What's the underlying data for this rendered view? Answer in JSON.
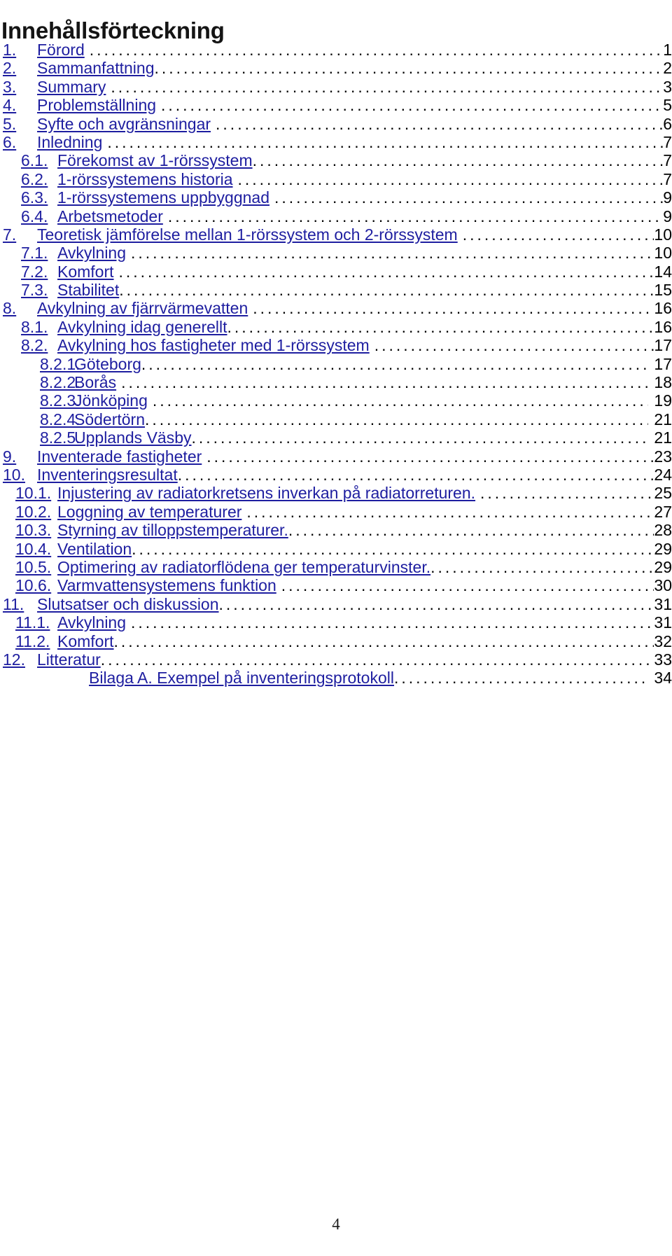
{
  "document": {
    "title": "Innehållsförteckning",
    "footer_page_number": "4",
    "link_color": "#1e1ea0",
    "title_color": "#141414",
    "page_number_color": "#000000"
  },
  "toc": {
    "entries": [
      {
        "level": 1,
        "number": "1.",
        "label": "Förord",
        "page": "1",
        "space_before_dots": true,
        "space_after_dots": false
      },
      {
        "level": 1,
        "number": "2.",
        "label": "Sammanfattning",
        "page": "2",
        "space_before_dots": false,
        "space_after_dots": false
      },
      {
        "level": 1,
        "number": "3.",
        "label": "Summary",
        "page": "3",
        "space_before_dots": true,
        "space_after_dots": false
      },
      {
        "level": 1,
        "number": "4.",
        "label": "Problemställning",
        "page": "5",
        "space_before_dots": true,
        "space_after_dots": false
      },
      {
        "level": 1,
        "number": "5.",
        "label": "Syfte och avgränsningar",
        "page": "6",
        "space_before_dots": true,
        "space_after_dots": false
      },
      {
        "level": 1,
        "number": "6.",
        "label": "Inledning",
        "page": "7",
        "space_before_dots": true,
        "space_after_dots": false
      },
      {
        "level": 2,
        "number": "6.1.",
        "label": "Förekomst av 1-rörssystem",
        "page": "7",
        "space_before_dots": false,
        "space_after_dots": false
      },
      {
        "level": 2,
        "number": "6.2.",
        "label": "1-rörssystemens historia",
        "page": "7",
        "space_before_dots": true,
        "space_after_dots": false
      },
      {
        "level": 2,
        "number": "6.3.",
        "label": "1-rörssystemens uppbyggnad",
        "page": "9",
        "space_before_dots": true,
        "space_after_dots": false
      },
      {
        "level": 2,
        "number": "6.4.",
        "label": "Arbetsmetoder",
        "page": "9",
        "space_before_dots": true,
        "space_after_dots": false
      },
      {
        "level": 1,
        "number": "7.",
        "label": "Teoretisk jämförelse mellan 1-rörssystem och 2-rörssystem",
        "page": "10",
        "space_before_dots": true,
        "space_after_dots": false
      },
      {
        "level": 2,
        "number": "7.1.",
        "label": "Avkylning",
        "page": "10",
        "space_before_dots": true,
        "space_after_dots": false
      },
      {
        "level": 2,
        "number": "7.2.",
        "label": "Komfort",
        "page": "14",
        "space_before_dots": true,
        "space_after_dots": false
      },
      {
        "level": 2,
        "number": "7.3.",
        "label": "Stabilitet",
        "page": "15",
        "space_before_dots": false,
        "space_after_dots": false
      },
      {
        "level": 1,
        "number": "8.",
        "label": "Avkylning av fjärrvärmevatten",
        "page": "16",
        "space_before_dots": true,
        "space_after_dots": false
      },
      {
        "level": 2,
        "number": "8.1.",
        "label": "Avkylning idag generellt",
        "page": "16",
        "space_before_dots": false,
        "space_after_dots": false
      },
      {
        "level": 2,
        "number": "8.2.",
        "label": "Avkylning hos fastigheter med 1-rörssystem",
        "page": "17",
        "space_before_dots": true,
        "space_after_dots": false
      },
      {
        "level": 3,
        "number": "8.2.1.",
        "label": "Göteborg",
        "page": "17",
        "space_before_dots": false,
        "space_after_dots": true
      },
      {
        "level": 3,
        "number": "8.2.2.",
        "label": "Borås",
        "page": "18",
        "space_before_dots": true,
        "space_after_dots": true
      },
      {
        "level": 3,
        "number": "8.2.3.",
        "label": "Jönköping",
        "page": "19",
        "space_before_dots": true,
        "space_after_dots": true
      },
      {
        "level": 3,
        "number": "8.2.4.",
        "label": "Södertörn",
        "page": "21",
        "space_before_dots": false,
        "space_after_dots": true
      },
      {
        "level": 3,
        "number": "8.2.5.",
        "label": "Upplands Väsby",
        "page": "21",
        "space_before_dots": false,
        "space_after_dots": true
      },
      {
        "level": 1,
        "number": "9.",
        "label": "Inventerade fastigheter",
        "page": "23",
        "space_before_dots": true,
        "space_after_dots": false
      },
      {
        "level": 1,
        "number": "10.",
        "label": "Inventeringsresultat",
        "page": "24",
        "space_before_dots": false,
        "space_after_dots": false
      },
      {
        "level": 2,
        "number": "10.1.",
        "label": "Injustering av radiatorkretsens inverkan på radiatorreturen.",
        "page": "25",
        "space_before_dots": true,
        "space_after_dots": false,
        "wide_number": true
      },
      {
        "level": 2,
        "number": "10.2.",
        "label": "Loggning av temperaturer",
        "page": "27",
        "space_before_dots": true,
        "space_after_dots": false,
        "wide_number": true
      },
      {
        "level": 2,
        "number": "10.3.",
        "label": "Styrning av tilloppstemperaturer.",
        "page": "28",
        "space_before_dots": false,
        "space_after_dots": false,
        "wide_number": true
      },
      {
        "level": 2,
        "number": "10.4.",
        "label": "Ventilation",
        "page": "29",
        "space_before_dots": false,
        "space_after_dots": false,
        "wide_number": true
      },
      {
        "level": 2,
        "number": "10.5.",
        "label": "Optimering av radiatorflödena ger temperaturvinster.",
        "page": "29",
        "space_before_dots": false,
        "space_after_dots": false,
        "wide_number": true
      },
      {
        "level": 2,
        "number": "10.6.",
        "label": "Varmvattensystemens funktion",
        "page": "30",
        "space_before_dots": true,
        "space_after_dots": false,
        "wide_number": true
      },
      {
        "level": 1,
        "number": "11.",
        "label": "Slutsatser och diskussion",
        "page": "31",
        "space_before_dots": false,
        "space_after_dots": false
      },
      {
        "level": 2,
        "number": "11.1.",
        "label": "Avkylning",
        "page": "31",
        "space_before_dots": true,
        "space_after_dots": false,
        "wide_number": true
      },
      {
        "level": 2,
        "number": "11.2.",
        "label": "Komfort",
        "page": "32",
        "space_before_dots": false,
        "space_after_dots": false,
        "wide_number": true
      },
      {
        "level": 1,
        "number": "12.",
        "label": "Litteratur",
        "page": "33",
        "space_before_dots": false,
        "space_after_dots": false
      },
      {
        "level": 4,
        "number": "",
        "label": "Bilaga A. Exempel på inventeringsprotokoll",
        "page": "34",
        "space_before_dots": false,
        "space_after_dots": true
      }
    ]
  }
}
